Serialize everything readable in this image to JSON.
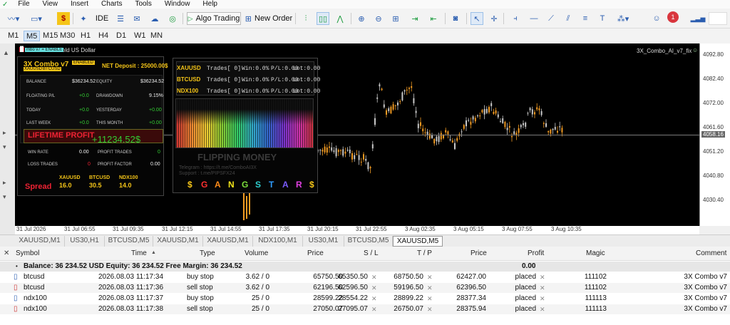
{
  "menu": [
    "File",
    "View",
    "Insert",
    "Charts",
    "Tools",
    "Window",
    "Help"
  ],
  "toolbar": {
    "ide": "IDE",
    "algo_trading": "Algo Trading",
    "new_order": "New Order",
    "notif_count": "1"
  },
  "timeframes": [
    "M1",
    "M5",
    "M15",
    "M30",
    "H1",
    "H4",
    "D1",
    "W1",
    "MN"
  ],
  "selected_timeframe": "M5",
  "chart": {
    "symbol_title": "old US Dollar",
    "ea_label": "3X_Combo_AI_v7_fix",
    "ea_small_tag": "mbo v7 = ENABLE",
    "current_price": "4058.16",
    "price_labels": [
      "4092.80",
      "4082.40",
      "4072.00",
      "4061.60",
      "4058.16",
      "4051.20",
      "4040.80",
      "4030.40"
    ],
    "time_labels": [
      "31 Jul 2026",
      "31 Jul 06:55",
      "31 Jul 09:35",
      "31 Jul 12:15",
      "31 Jul 14:55",
      "31 Jul 17:35",
      "31 Jul 20:15",
      "31 Jul 22:55",
      "3 Aug 02:35",
      "3 Aug 05:15",
      "3 Aug 07:55",
      "3 Aug 10:35"
    ]
  },
  "ea_panel": {
    "title": "3X Combo v7",
    "enabled": "ENABLED",
    "tags": [
      "XAUUSD",
      "BTCUSD"
    ],
    "net_deposit": "NET Deposit : 25000.00$",
    "balance_label": "BALANCE",
    "balance_value": "$36234.52",
    "equity_label": "EQUITY",
    "equity_value": "$36234.52",
    "floating_label": "FLOATING P/L",
    "floating_value": "+0.0",
    "drawdown_label": "DRAWDOWN",
    "drawdown_value": "9.15%",
    "today_label": "TODAY",
    "today_value": "+0.0",
    "yesterday_label": "YESTERDAY",
    "yesterday_value": "+0.00",
    "lastweek_label": "LAST WEEK",
    "lastweek_value": "+0.0",
    "thismonth_label": "THIS MONTH",
    "thismonth_value": "+0.00",
    "lifetime_label": "LIFETIME PROFIT",
    "lifetime_value": "+11234.52$",
    "winrate_label": "WIN RATE",
    "winrate_value": "0.00",
    "profittrades_label": "PROFIT TRADES",
    "profittrades_value": "0",
    "losstrades_label": "LOSS TRADES",
    "losstrades_value": "0",
    "profitfactor_label": "PROFIT FACTOR",
    "profitfactor_value": "0.00",
    "spread_label": "Spread",
    "spreads": [
      {
        "sym": "XAUUSD",
        "val": "16.0"
      },
      {
        "sym": "BTCUSD",
        "val": "30.5"
      },
      {
        "sym": "NDX100",
        "val": "14.0"
      }
    ],
    "symbols": [
      {
        "name": "XAUUSD",
        "trades": "Trades[ 0]",
        "win": "Win:0.0%",
        "pnl": "P/L:0.00",
        "lot": "Lot:0.00"
      },
      {
        "name": "BTCUSD",
        "trades": "Trades[ 0]",
        "win": "Win:0.0%",
        "pnl": "P/L:0.00",
        "lot": "Lot:0.00"
      },
      {
        "name": "NDX100",
        "trades": "Trades[ 0]",
        "win": "Win:0.0%",
        "pnl": "P/L:0.00",
        "lot": "Lot:0.00"
      }
    ],
    "flipping": "FLIPPING MONEY",
    "telegram": "Telegram : https://t.me/ComboAI3X",
    "support": "Support : t.me/PIPSFX24",
    "gangstar": [
      "$",
      "G",
      "A",
      "N",
      "G",
      "S",
      "T",
      "A",
      "R",
      "$"
    ]
  },
  "chart_tabs": [
    "XAUUSD,M1",
    "US30,H1",
    "BTCUSD,M5",
    "XAUUSD,M1",
    "XAUUSD,M1",
    "NDX100,M1",
    "US30,M1",
    "BTCUSD,M5",
    "XAUUSD,M5"
  ],
  "selected_tab": "XAUUSD,M5",
  "table": {
    "headers": [
      "Symbol",
      "Time",
      "Type",
      "Volume",
      "Price",
      "S / L",
      "T / P",
      "Price",
      "Profit",
      "Magic",
      "Comment"
    ],
    "balance_line": "Balance: 36 234.52 USD  Equity: 36 234.52  Free Margin: 36 234.52",
    "balance_profit": "0.00",
    "rows": [
      {
        "symbol": "btcusd",
        "time": "2026.08.03 11:17:34",
        "type": "buy stop",
        "volume": "3.62 / 0",
        "price": "65750.50",
        "sl": "65350.50",
        "tp": "68750.50",
        "cur": "62427.00",
        "profit": "placed",
        "magic": "111102",
        "comment": "3X Combo v7"
      },
      {
        "symbol": "btcusd",
        "time": "2026.08.03 11:17:36",
        "type": "sell stop",
        "volume": "3.62 / 0",
        "price": "62196.50",
        "sl": "62596.50",
        "tp": "59196.50",
        "cur": "62396.50",
        "profit": "placed",
        "magic": "111102",
        "comment": "3X Combo v7"
      },
      {
        "symbol": "ndx100",
        "time": "2026.08.03 11:17:37",
        "type": "buy stop",
        "volume": "25 / 0",
        "price": "28599.22",
        "sl": "28554.22",
        "tp": "28899.22",
        "cur": "28377.34",
        "profit": "placed",
        "magic": "111113",
        "comment": "3X Combo v7"
      },
      {
        "symbol": "ndx100",
        "time": "2026.08.03 11:17:38",
        "type": "sell stop",
        "volume": "25 / 0",
        "price": "27050.07",
        "sl": "27095.07",
        "tp": "26750.07",
        "cur": "28375.94",
        "profit": "placed",
        "magic": "111113",
        "comment": "3X Combo v7"
      }
    ]
  }
}
